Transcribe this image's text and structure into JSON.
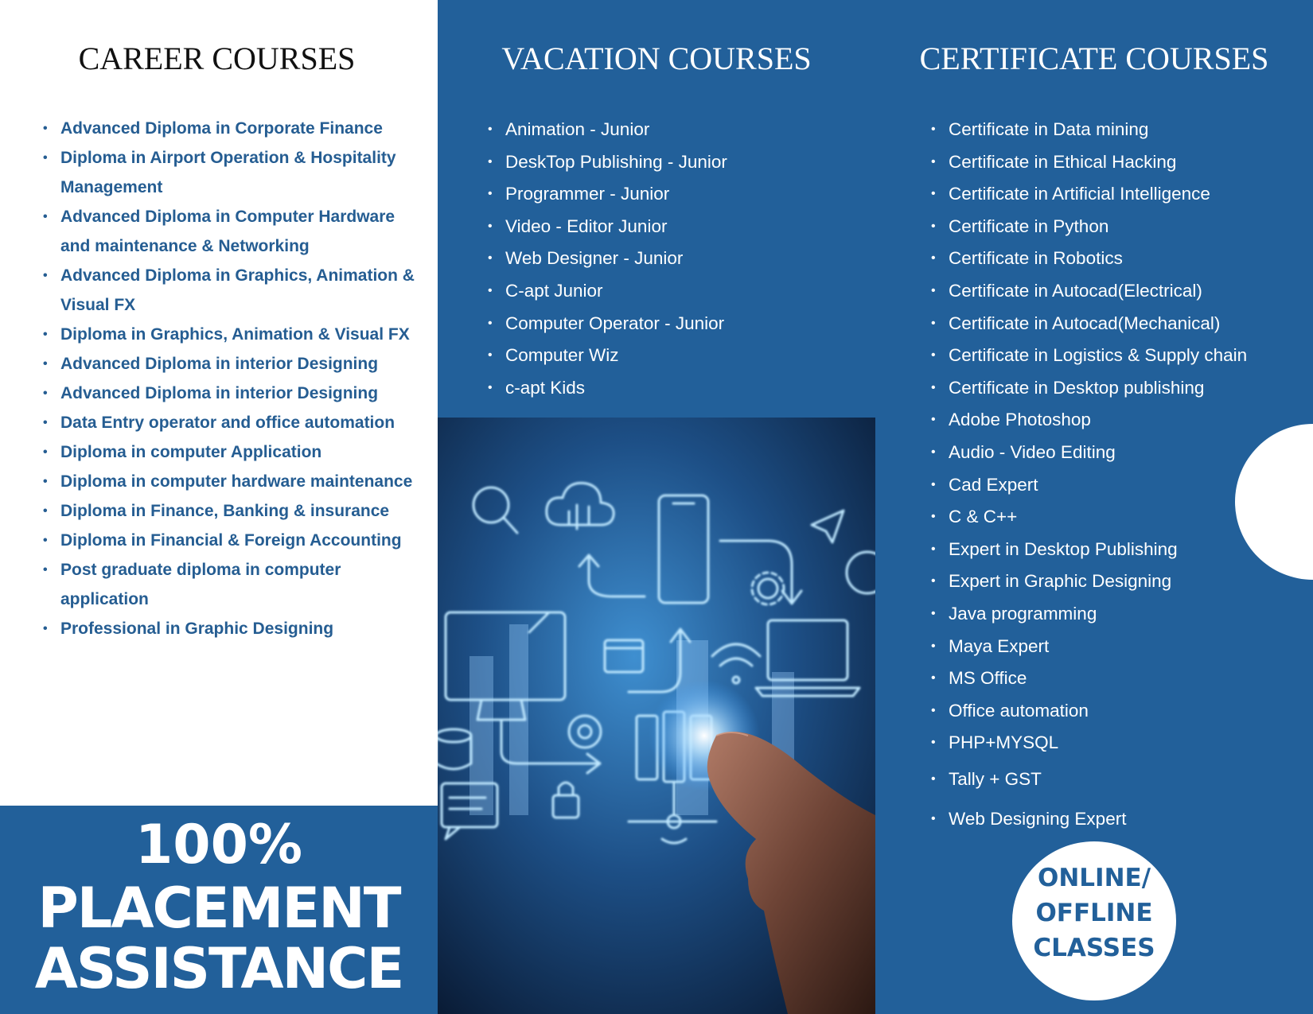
{
  "colors": {
    "brand_blue": "#22609a",
    "list_text_blue": "#255d92",
    "white": "#ffffff"
  },
  "career": {
    "title": "CAREER COURSES",
    "items": [
      "Advanced Diploma in Corporate Finance",
      "Diploma in Airport Operation & Hospitality Management",
      "Advanced Diploma in Computer Hardware and maintenance & Networking",
      "Advanced Diploma in Graphics, Animation & Visual FX",
      "Diploma in Graphics, Animation & Visual FX",
      "Advanced Diploma in interior Designing",
      "Advanced Diploma in interior Designing",
      "Data Entry operator and office automation",
      "Diploma in computer Application",
      "Diploma in computer hardware maintenance",
      "Diploma in Finance, Banking & insurance",
      "Diploma in Financial & Foreign Accounting",
      "Post graduate diploma in computer application",
      "Professional in Graphic Designing"
    ]
  },
  "placement": {
    "line1": "100%",
    "line2": "PLACEMENT",
    "line3": "ASSISTANCE"
  },
  "vacation": {
    "title": "VACATION COURSES",
    "items": [
      "Animation - Junior",
      "DeskTop Publishing - Junior",
      "Programmer - Junior",
      "Video - Editor Junior",
      "Web Designer - Junior",
      "C-apt Junior",
      "Computer Operator - Junior",
      "Computer Wiz",
      "c-apt Kids"
    ]
  },
  "certificate": {
    "title": "CERTIFICATE COURSES",
    "items": [
      "Certificate in Data mining",
      "Certificate in Ethical Hacking",
      "Certificate in Artificial Intelligence",
      "Certificate in Python",
      "Certificate in Robotics",
      "Certificate in Autocad(Electrical)",
      "Certificate in Autocad(Mechanical)",
      "Certificate in Logistics & Supply chain",
      "Certificate in Desktop publishing",
      "Adobe Photoshop",
      "Audio - Video Editing",
      "Cad Expert",
      "C & C++",
      "Expert in Desktop Publishing",
      "Expert in Graphic Designing",
      "Java programming",
      "Maya Expert",
      "MS Office",
      "Office automation",
      "PHP+MYSQL",
      "Tally + GST",
      "Web Designing Expert"
    ]
  },
  "badge": {
    "line1": "ONLINE/",
    "line2": "OFFLINE",
    "line3": "CLASSES"
  },
  "illustration": {
    "icons": [
      "search-icon",
      "cloud-circuit-icon",
      "smartphone-icon",
      "paper-plane-icon",
      "globe-icon",
      "gear-icon",
      "monitor-icon",
      "browser-www-icon",
      "wifi-icon",
      "laptop-icon",
      "at-sign-icon",
      "database-icon",
      "server-icon",
      "padlock-icon",
      "chat-icon",
      "network-node-icon",
      "pointing-finger"
    ]
  }
}
